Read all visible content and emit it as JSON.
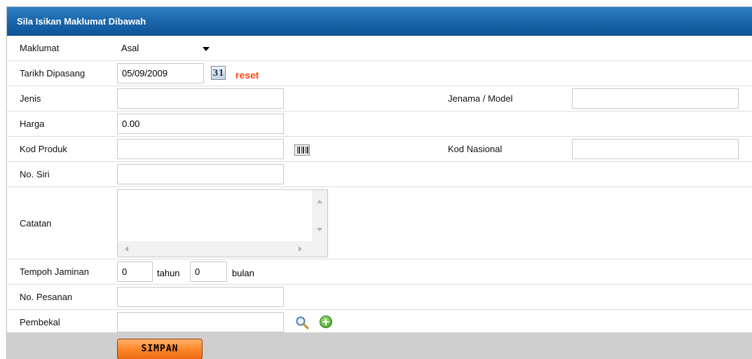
{
  "header": {
    "title": "Sila Isikan Maklumat Dibawah"
  },
  "form": {
    "maklumat": {
      "label": "Maklumat",
      "selected": "Asal"
    },
    "tarikh": {
      "label": "Tarikh Dipasang",
      "value": "05/09/2009",
      "calendar_glyph": "31",
      "reset_label": "reset"
    },
    "jenis": {
      "label": "Jenis",
      "value": ""
    },
    "jenama": {
      "label": "Jenama / Model",
      "value": ""
    },
    "harga": {
      "label": "Harga",
      "value": "0.00"
    },
    "kod_produk": {
      "label": "Kod Produk",
      "value": ""
    },
    "kod_nasional": {
      "label": "Kod Nasional",
      "value": ""
    },
    "no_siri": {
      "label": "No. Siri",
      "value": ""
    },
    "catatan": {
      "label": "Catatan",
      "value": ""
    },
    "tempoh": {
      "label": "Tempoh Jaminan",
      "tahun_value": "0",
      "tahun_label": "tahun",
      "bulan_value": "0",
      "bulan_label": "bulan"
    },
    "no_pesanan": {
      "label": "No. Pesanan",
      "value": ""
    },
    "pembekal": {
      "label": "Pembekal",
      "value": "",
      "add_glyph": "+"
    }
  },
  "footer": {
    "save_label": "SIMPAN"
  },
  "colors": {
    "header": "#1c68ad",
    "reset": "#ff4a1c",
    "button": "#ff8a2e"
  },
  "icons": [
    "calendar-icon",
    "barcode-icon",
    "search-icon",
    "add-icon",
    "dropdown-arrow-icon"
  ]
}
